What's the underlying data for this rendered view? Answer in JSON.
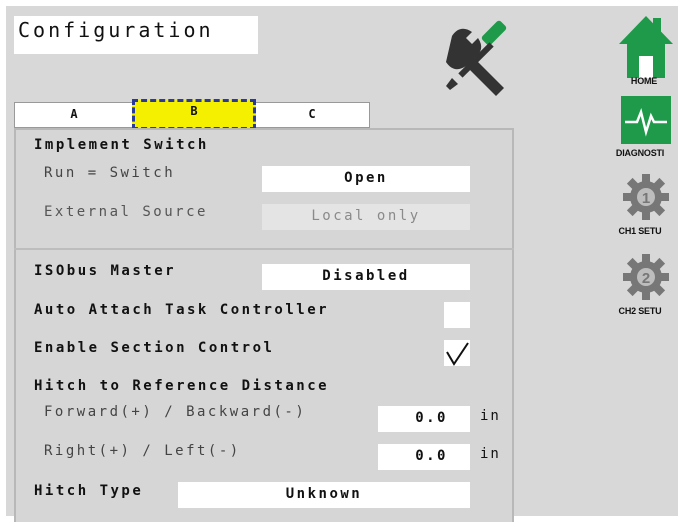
{
  "screen": {
    "title": "Configuration"
  },
  "tabs": [
    {
      "label": "A",
      "active": false
    },
    {
      "label": "B",
      "active": true
    },
    {
      "label": "C",
      "active": false
    }
  ],
  "implement_switch": {
    "heading": "Implement Switch",
    "run_label": "Run = Switch",
    "run_value": "Open",
    "external_label": "External Source",
    "external_value": "Local only"
  },
  "isobus": {
    "master_label": "ISObus Master",
    "master_value": "Disabled",
    "auto_attach_label": "Auto Attach Task Controller",
    "auto_attach_checked": false,
    "section_control_label": "Enable Section Control",
    "section_control_checked": true
  },
  "hitch": {
    "heading": "Hitch to Reference Distance",
    "forward_label": "Forward(+) / Backward(-)",
    "forward_value": "0.0",
    "forward_unit": "in",
    "right_label": "Right(+) / Left(-)",
    "right_value": "0.0",
    "right_unit": "in",
    "type_label": "Hitch Type",
    "type_value": "Unknown"
  },
  "sidebar": {
    "home": "HOME",
    "diagnostics": "DIAGNOSTI",
    "ch1": "CH1 SETU",
    "ch2": "CH2 SETU"
  },
  "colors": {
    "accent_green": "#1f9a4a",
    "active_tab": "#f4f000",
    "tab_border": "#2a3a9a",
    "gear_gray": "#777777"
  }
}
